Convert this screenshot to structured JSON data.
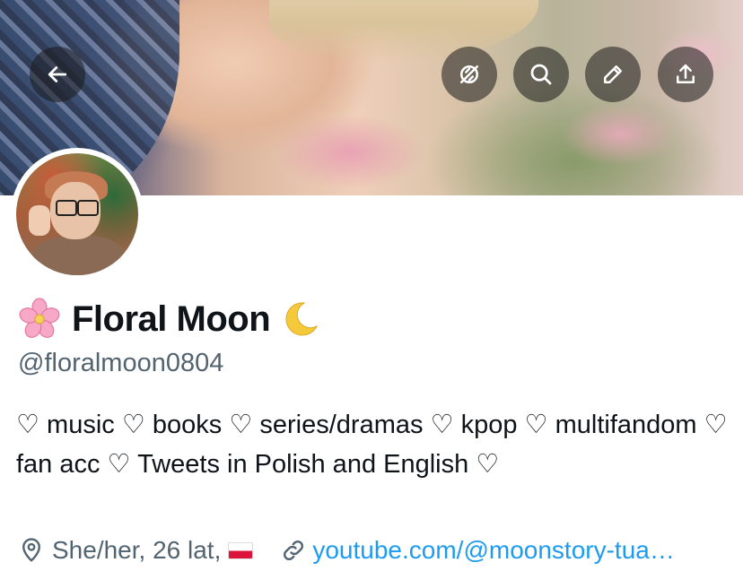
{
  "profile": {
    "display_name": "Floral Moon",
    "name_prefix_emoji": "cherry-blossom-icon",
    "name_suffix_emoji": "crescent-moon-icon",
    "handle": "@floralmoon0804",
    "bio": "♡ music ♡ books ♡ series/dramas ♡ kpop ♡ multifandom ♡ fan acc ♡ Tweets in Polish and English ♡",
    "location": "She/her, 26 lat,",
    "location_flag": "poland-flag-icon",
    "website": "youtube.com/@moonstory-tua…"
  },
  "header_actions": [
    {
      "name": "back-button",
      "icon": "arrow-left-icon"
    },
    {
      "name": "circle-button",
      "icon": "circle-slash-icon"
    },
    {
      "name": "search-button",
      "icon": "search-icon"
    },
    {
      "name": "edit-button",
      "icon": "pencil-icon"
    },
    {
      "name": "share-button",
      "icon": "share-upload-icon"
    }
  ],
  "colors": {
    "text_primary": "#0f1419",
    "text_secondary": "#536471",
    "link": "#1d9bf0"
  }
}
